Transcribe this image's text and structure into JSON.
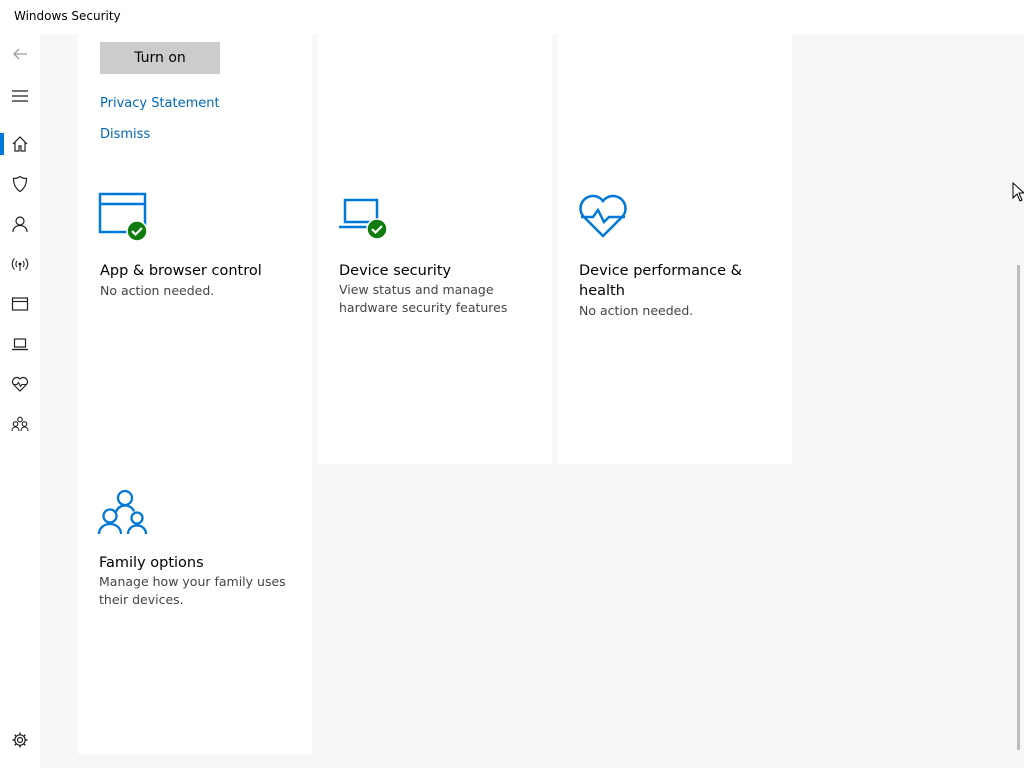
{
  "window": {
    "title": "Windows Security"
  },
  "nav": {
    "items": [
      {
        "icon": "back-arrow-icon"
      },
      {
        "icon": "hamburger-menu-icon"
      },
      {
        "icon": "home-icon",
        "active": true
      },
      {
        "icon": "shield-icon"
      },
      {
        "icon": "person-icon"
      },
      {
        "icon": "wireless-icon"
      },
      {
        "icon": "app-window-icon"
      },
      {
        "icon": "laptop-icon"
      },
      {
        "icon": "heart-pulse-icon"
      },
      {
        "icon": "family-icon"
      },
      {
        "icon": "gear-icon"
      }
    ]
  },
  "banner": {
    "turn_on_label": "Turn on",
    "privacy_label": "Privacy Statement",
    "dismiss_label": "Dismiss"
  },
  "cards": {
    "app_browser": {
      "title": "App & browser control",
      "desc": "No action needed."
    },
    "device_security": {
      "title": "Device security",
      "desc_line1": "View status and manage",
      "desc_line2": "hardware security features"
    },
    "device_performance": {
      "title_line1": "Device performance &",
      "title_line2": "health",
      "desc": "No action needed."
    },
    "family": {
      "title": "Family options",
      "desc_line1": "Manage how your family uses",
      "desc_line2": "their devices."
    }
  },
  "colors": {
    "accent": "#0078d7",
    "link": "#0067b8",
    "status_ok": "#107c10"
  }
}
